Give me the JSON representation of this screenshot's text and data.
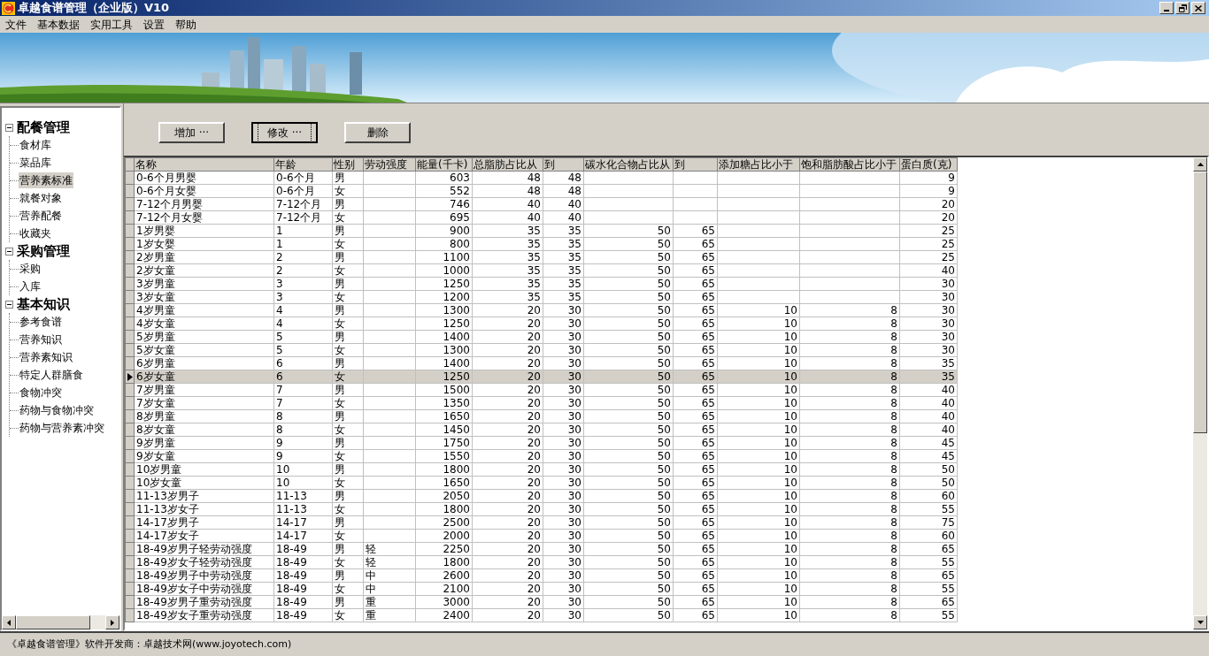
{
  "window": {
    "title": "卓越食谱管理（企业版）V10"
  },
  "menu": [
    "文件",
    "基本数据",
    "实用工具",
    "设置",
    "帮助"
  ],
  "tree": [
    {
      "label": "配餐管理",
      "expanded": true,
      "children": [
        {
          "label": "食材库",
          "selected": false
        },
        {
          "label": "菜品库",
          "selected": false
        },
        {
          "label": "营养素标准",
          "selected": true
        },
        {
          "label": "就餐对象",
          "selected": false
        },
        {
          "label": "营养配餐",
          "selected": false
        },
        {
          "label": "收藏夹",
          "selected": false
        }
      ]
    },
    {
      "label": "采购管理",
      "expanded": true,
      "children": [
        {
          "label": "采购",
          "selected": false
        },
        {
          "label": "入库",
          "selected": false
        }
      ]
    },
    {
      "label": "基本知识",
      "expanded": true,
      "children": [
        {
          "label": "参考食谱",
          "selected": false
        },
        {
          "label": "营养知识",
          "selected": false
        },
        {
          "label": "营养素知识",
          "selected": false
        },
        {
          "label": "特定人群膳食",
          "selected": false
        },
        {
          "label": "食物冲突",
          "selected": false
        },
        {
          "label": "药物与食物冲突",
          "selected": false
        },
        {
          "label": "药物与营养素冲突",
          "selected": false
        }
      ]
    }
  ],
  "buttons": [
    {
      "label": "增加 ···",
      "focused": false
    },
    {
      "label": "修改 ···",
      "focused": true
    },
    {
      "label": "删除",
      "focused": false
    }
  ],
  "table": {
    "columns": [
      "名称",
      "年龄",
      "性别",
      "劳动强度",
      "能量(千卡)",
      "总脂肪占比从",
      "到",
      "碳水化合物占比从",
      "到",
      "添加糖占比小于",
      "饱和脂肪酸占比小于",
      "蛋白质(克)"
    ],
    "rows": [
      {
        "selected": false,
        "cells": [
          "0-6个月男婴",
          "0-6个月",
          "男",
          null,
          "603",
          "48",
          "48",
          null,
          null,
          null,
          null,
          "9"
        ]
      },
      {
        "selected": false,
        "cells": [
          "0-6个月女婴",
          "0-6个月",
          "女",
          null,
          "552",
          "48",
          "48",
          null,
          null,
          null,
          null,
          "9"
        ]
      },
      {
        "selected": false,
        "cells": [
          "7-12个月男婴",
          "7-12个月",
          "男",
          null,
          "746",
          "40",
          "40",
          null,
          null,
          null,
          null,
          "20"
        ]
      },
      {
        "selected": false,
        "cells": [
          "7-12个月女婴",
          "7-12个月",
          "女",
          null,
          "695",
          "40",
          "40",
          null,
          null,
          null,
          null,
          "20"
        ]
      },
      {
        "selected": false,
        "cells": [
          "1岁男婴",
          "1",
          "男",
          null,
          "900",
          "35",
          "35",
          "50",
          "65",
          null,
          null,
          "25"
        ]
      },
      {
        "selected": false,
        "cells": [
          "1岁女婴",
          "1",
          "女",
          null,
          "800",
          "35",
          "35",
          "50",
          "65",
          null,
          null,
          "25"
        ]
      },
      {
        "selected": false,
        "cells": [
          "2岁男童",
          "2",
          "男",
          null,
          "1100",
          "35",
          "35",
          "50",
          "65",
          null,
          null,
          "25"
        ]
      },
      {
        "selected": false,
        "cells": [
          "2岁女童",
          "2",
          "女",
          null,
          "1000",
          "35",
          "35",
          "50",
          "65",
          null,
          null,
          "40"
        ]
      },
      {
        "selected": false,
        "cells": [
          "3岁男童",
          "3",
          "男",
          null,
          "1250",
          "35",
          "35",
          "50",
          "65",
          null,
          null,
          "30"
        ]
      },
      {
        "selected": false,
        "cells": [
          "3岁女童",
          "3",
          "女",
          null,
          "1200",
          "35",
          "35",
          "50",
          "65",
          null,
          null,
          "30"
        ]
      },
      {
        "selected": false,
        "cells": [
          "4岁男童",
          "4",
          "男",
          null,
          "1300",
          "20",
          "30",
          "50",
          "65",
          "10",
          "8",
          "30"
        ]
      },
      {
        "selected": false,
        "cells": [
          "4岁女童",
          "4",
          "女",
          null,
          "1250",
          "20",
          "30",
          "50",
          "65",
          "10",
          "8",
          "30"
        ]
      },
      {
        "selected": false,
        "cells": [
          "5岁男童",
          "5",
          "男",
          null,
          "1400",
          "20",
          "30",
          "50",
          "65",
          "10",
          "8",
          "30"
        ]
      },
      {
        "selected": false,
        "cells": [
          "5岁女童",
          "5",
          "女",
          null,
          "1300",
          "20",
          "30",
          "50",
          "65",
          "10",
          "8",
          "30"
        ]
      },
      {
        "selected": false,
        "cells": [
          "6岁男童",
          "6",
          "男",
          null,
          "1400",
          "20",
          "30",
          "50",
          "65",
          "10",
          "8",
          "35"
        ]
      },
      {
        "selected": true,
        "cells": [
          "6岁女童",
          "6",
          "女",
          null,
          "1250",
          "20",
          "30",
          "50",
          "65",
          "10",
          "8",
          "35"
        ]
      },
      {
        "selected": false,
        "cells": [
          "7岁男童",
          "7",
          "男",
          null,
          "1500",
          "20",
          "30",
          "50",
          "65",
          "10",
          "8",
          "40"
        ]
      },
      {
        "selected": false,
        "cells": [
          "7岁女童",
          "7",
          "女",
          null,
          "1350",
          "20",
          "30",
          "50",
          "65",
          "10",
          "8",
          "40"
        ]
      },
      {
        "selected": false,
        "cells": [
          "8岁男童",
          "8",
          "男",
          null,
          "1650",
          "20",
          "30",
          "50",
          "65",
          "10",
          "8",
          "40"
        ]
      },
      {
        "selected": false,
        "cells": [
          "8岁女童",
          "8",
          "女",
          null,
          "1450",
          "20",
          "30",
          "50",
          "65",
          "10",
          "8",
          "40"
        ]
      },
      {
        "selected": false,
        "cells": [
          "9岁男童",
          "9",
          "男",
          null,
          "1750",
          "20",
          "30",
          "50",
          "65",
          "10",
          "8",
          "45"
        ]
      },
      {
        "selected": false,
        "cells": [
          "9岁女童",
          "9",
          "女",
          null,
          "1550",
          "20",
          "30",
          "50",
          "65",
          "10",
          "8",
          "45"
        ]
      },
      {
        "selected": false,
        "cells": [
          "10岁男童",
          "10",
          "男",
          null,
          "1800",
          "20",
          "30",
          "50",
          "65",
          "10",
          "8",
          "50"
        ]
      },
      {
        "selected": false,
        "cells": [
          "10岁女童",
          "10",
          "女",
          null,
          "1650",
          "20",
          "30",
          "50",
          "65",
          "10",
          "8",
          "50"
        ]
      },
      {
        "selected": false,
        "cells": [
          "11-13岁男子",
          "11-13",
          "男",
          null,
          "2050",
          "20",
          "30",
          "50",
          "65",
          "10",
          "8",
          "60"
        ]
      },
      {
        "selected": false,
        "cells": [
          "11-13岁女子",
          "11-13",
          "女",
          null,
          "1800",
          "20",
          "30",
          "50",
          "65",
          "10",
          "8",
          "55"
        ]
      },
      {
        "selected": false,
        "cells": [
          "14-17岁男子",
          "14-17",
          "男",
          null,
          "2500",
          "20",
          "30",
          "50",
          "65",
          "10",
          "8",
          "75"
        ]
      },
      {
        "selected": false,
        "cells": [
          "14-17岁女子",
          "14-17",
          "女",
          null,
          "2000",
          "20",
          "30",
          "50",
          "65",
          "10",
          "8",
          "60"
        ]
      },
      {
        "selected": false,
        "cells": [
          "18-49岁男子轻劳动强度",
          "18-49",
          "男",
          "轻",
          "2250",
          "20",
          "30",
          "50",
          "65",
          "10",
          "8",
          "65"
        ]
      },
      {
        "selected": false,
        "cells": [
          "18-49岁女子轻劳动强度",
          "18-49",
          "女",
          "轻",
          "1800",
          "20",
          "30",
          "50",
          "65",
          "10",
          "8",
          "55"
        ]
      },
      {
        "selected": false,
        "cells": [
          "18-49岁男子中劳动强度",
          "18-49",
          "男",
          "中",
          "2600",
          "20",
          "30",
          "50",
          "65",
          "10",
          "8",
          "65"
        ]
      },
      {
        "selected": false,
        "cells": [
          "18-49岁女子中劳动强度",
          "18-49",
          "女",
          "中",
          "2100",
          "20",
          "30",
          "50",
          "65",
          "10",
          "8",
          "55"
        ]
      },
      {
        "selected": false,
        "cells": [
          "18-49岁男子重劳动强度",
          "18-49",
          "男",
          "重",
          "3000",
          "20",
          "30",
          "50",
          "65",
          "10",
          "8",
          "65"
        ]
      },
      {
        "selected": false,
        "cells": [
          "18-49岁女子重劳动强度",
          "18-49",
          "女",
          "重",
          "2400",
          "20",
          "30",
          "50",
          "65",
          "10",
          "8",
          "55"
        ]
      }
    ]
  },
  "status_bar": "《卓越食谱管理》软件开发商：卓越技术网(www.joyotech.com)"
}
